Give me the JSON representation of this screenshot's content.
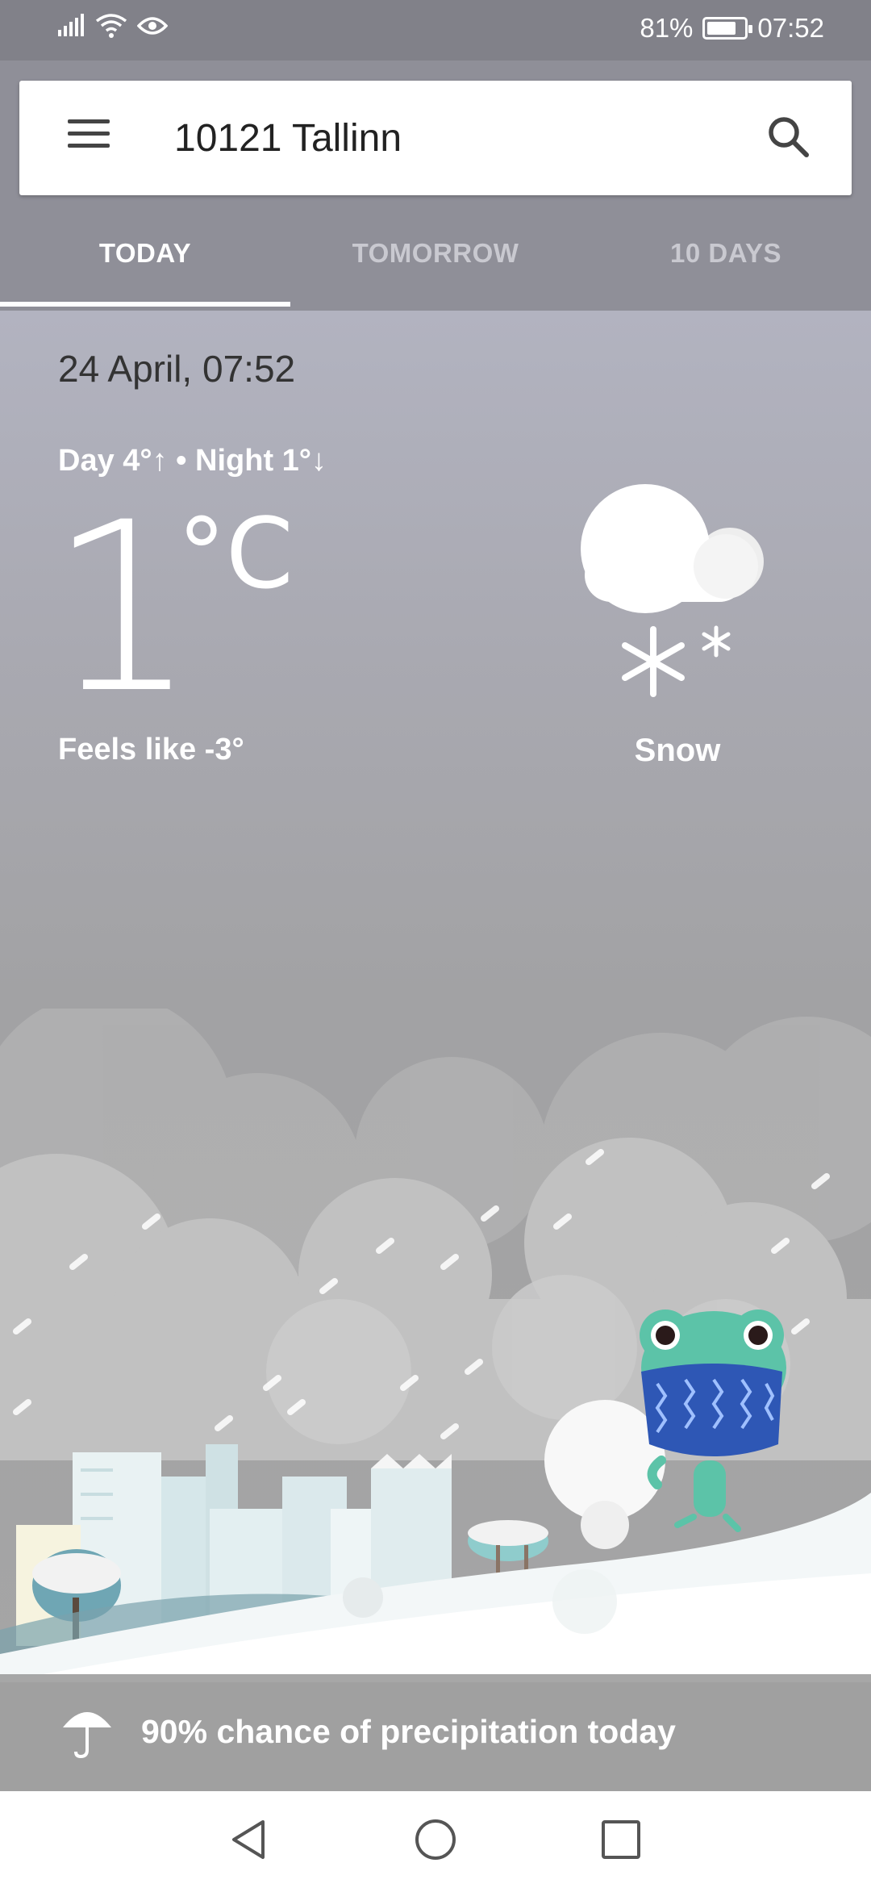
{
  "status_bar": {
    "battery": "81%",
    "battery_level": 0.81,
    "time": "07:52",
    "icons": [
      "signal-icon",
      "wifi-icon",
      "eye-icon",
      "battery-icon"
    ]
  },
  "search": {
    "location": "10121 Tallinn",
    "menu_icon": "menu-icon",
    "search_icon": "search-icon"
  },
  "tabs": [
    {
      "label": "TODAY",
      "active": true
    },
    {
      "label": "TOMORROW",
      "active": false
    },
    {
      "label": "10 DAYS",
      "active": false
    }
  ],
  "weather": {
    "date": "24 April, 07:52",
    "day_night": "Day 4°↑ • Night 1°↓",
    "temperature": "1",
    "unit": "°C",
    "feels_like": "Feels like -3°",
    "condition": "Snow",
    "condition_icon": "snow-cloud-icon"
  },
  "precipitation": {
    "text": "90% chance of precipitation today",
    "icon": "umbrella-icon"
  },
  "nav": {
    "icons": [
      "back-icon",
      "home-icon",
      "recents-icon"
    ]
  },
  "colors": {
    "status_bar": "#818189",
    "header": "#8f8f98",
    "tab_inactive": "#c9c9d0",
    "snow": "#ffffff",
    "frog": "#5cc3a8",
    "scarf": "#2e57b5"
  }
}
